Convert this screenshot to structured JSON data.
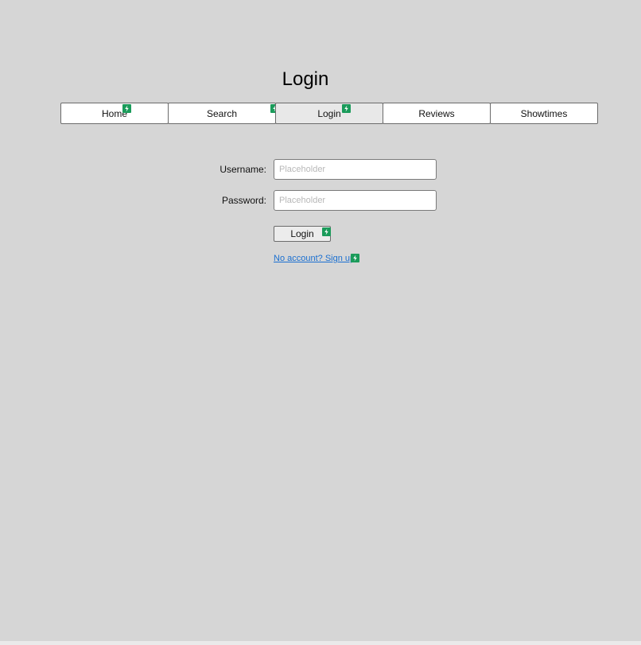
{
  "page": {
    "title": "Login"
  },
  "nav": {
    "tabs": [
      {
        "label": "Home",
        "badge": true,
        "active": false
      },
      {
        "label": "Search",
        "badge": true,
        "active": false
      },
      {
        "label": "Login",
        "badge": true,
        "active": true
      },
      {
        "label": "Reviews",
        "badge": false,
        "active": false
      },
      {
        "label": "Showtimes",
        "badge": false,
        "active": false
      }
    ]
  },
  "form": {
    "username_label": "Username:",
    "username_placeholder": "Placeholder",
    "password_label": "Password:",
    "password_placeholder": "Placeholder",
    "login_button": "Login",
    "signup_link": "No account? Sign up"
  },
  "icons": {
    "badge": "lightning-bolt-icon"
  },
  "colors": {
    "background": "#d6d6d6",
    "badge": "#1a9b5a",
    "link": "#1a6fd0"
  }
}
